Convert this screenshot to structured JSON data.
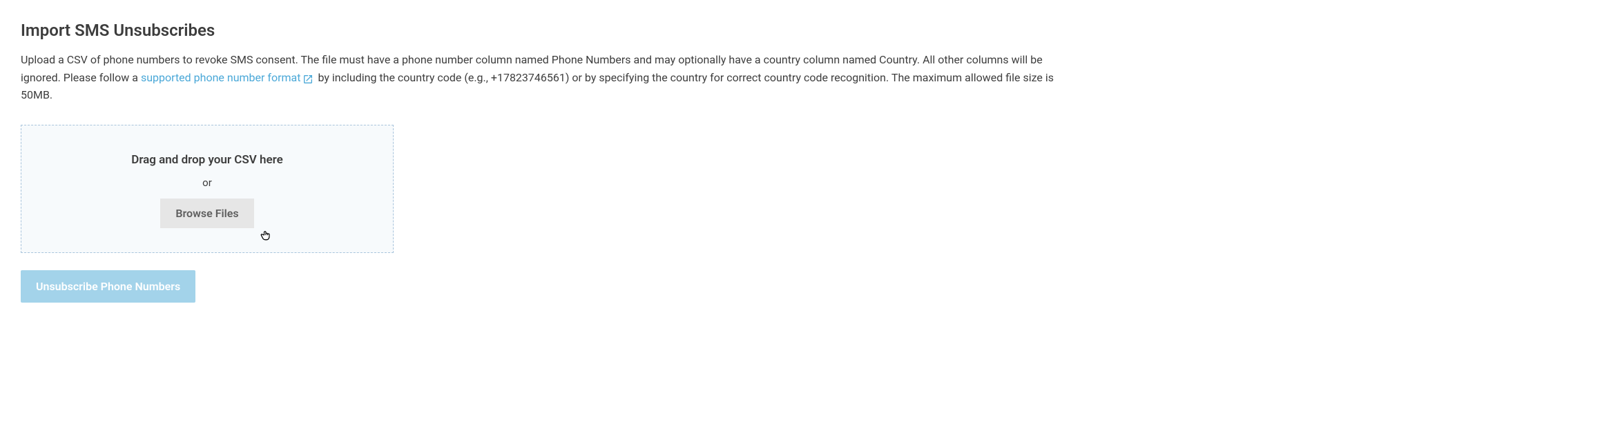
{
  "page": {
    "title": "Import SMS Unsubscribes",
    "description_part1": "Upload a CSV of phone numbers to revoke SMS consent. The file must have a phone number column named Phone Numbers and may optionally have a country column named Country. All other columns will be ignored. Please follow a ",
    "link_text": "supported phone number format",
    "description_part2": " by including the country code (e.g., +17823746561) or by specifying the country for correct country code recognition. The maximum allowed file size is 50MB."
  },
  "dropzone": {
    "title": "Drag and drop your CSV here",
    "or_text": "or",
    "browse_label": "Browse Files"
  },
  "submit": {
    "label": "Unsubscribe Phone Numbers"
  }
}
